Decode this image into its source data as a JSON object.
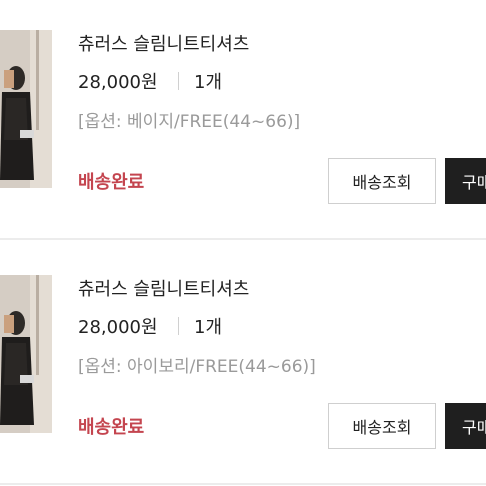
{
  "orders": [
    {
      "product_name": "츄러스 슬림니트티셔츠",
      "price": "28,000원",
      "quantity": "1개",
      "option": "[옵션: 베이지/FREE(44~66)]",
      "status": "배송완료",
      "track_button": "배송조회",
      "buy_button": "구매",
      "thumbnail_icon": "product-photo"
    },
    {
      "product_name": "츄러스 슬림니트티셔츠",
      "price": "28,000원",
      "quantity": "1개",
      "option": "[옵션: 아이보리/FREE(44~66)]",
      "status": "배송완료",
      "track_button": "배송조회",
      "buy_button": "구매",
      "thumbnail_icon": "product-photo"
    }
  ],
  "colors": {
    "status": "#c4454f",
    "buy_button_bg": "#1f1f1f",
    "divider": "#ececec"
  }
}
